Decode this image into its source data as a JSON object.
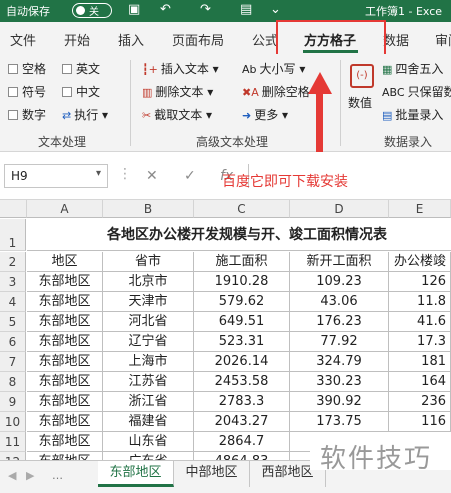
{
  "titlebar": {
    "autosave_label": "自动保存",
    "toggle_state": "关",
    "document_title": "工作簿1 - Exce"
  },
  "tabs": [
    "文件",
    "开始",
    "插入",
    "页面布局",
    "公式",
    "方方格子",
    "数据",
    "审阅"
  ],
  "active_tab": "方方格子",
  "ribbon": {
    "text_group": {
      "checkboxes": [
        "空格",
        "英文",
        "符号",
        "中文",
        "数字"
      ],
      "execute_label": "执行",
      "group_label": "文本处理"
    },
    "advanced_group": {
      "items": [
        "插入文本",
        "删除文本",
        "截取文本",
        "大小写",
        "删除空格",
        "更多"
      ],
      "group_label": "高级文本处理"
    },
    "value_group": {
      "value_label": "数值",
      "items": [
        "四舍五入",
        "只保留数",
        "批量录入"
      ],
      "group_label": "数据录入"
    }
  },
  "formula_bar": {
    "name_box": "H9",
    "fx": "fx",
    "cancel": "✕",
    "confirm": "✓"
  },
  "annotation": {
    "text": "百度它即可下载安装"
  },
  "sheet": {
    "columns": [
      "A",
      "B",
      "C",
      "D",
      "E"
    ],
    "rows": [
      "1",
      "2",
      "3",
      "4",
      "5",
      "6",
      "7",
      "8",
      "9",
      "10",
      "11",
      "12"
    ],
    "title": "各地区办公楼开发规模与开、竣工面积情况表",
    "headers": [
      "地区",
      "省市",
      "施工面积",
      "新开工面积",
      "办公楼竣"
    ],
    "data": [
      [
        "东部地区",
        "北京市",
        "1910.28",
        "109.23",
        "126"
      ],
      [
        "东部地区",
        "天津市",
        "579.62",
        "43.06",
        "11.8"
      ],
      [
        "东部地区",
        "河北省",
        "649.51",
        "176.23",
        "41.6"
      ],
      [
        "东部地区",
        "辽宁省",
        "523.31",
        "77.92",
        "17.3"
      ],
      [
        "东部地区",
        "上海市",
        "2026.14",
        "324.79",
        "181"
      ],
      [
        "东部地区",
        "江苏省",
        "2453.58",
        "330.23",
        "164"
      ],
      [
        "东部地区",
        "浙江省",
        "2783.3",
        "390.92",
        "236"
      ],
      [
        "东部地区",
        "福建省",
        "2043.27",
        "173.75",
        "116"
      ],
      [
        "东部地区",
        "山东省",
        "2864.7",
        "",
        ""
      ],
      [
        "东部地区",
        "广东省",
        "4864.83",
        "",
        ""
      ]
    ]
  },
  "sheet_tabs": [
    "东部地区",
    "中部地区",
    "西部地区"
  ],
  "active_sheet": "东部地区",
  "watermark": "软件技巧"
}
